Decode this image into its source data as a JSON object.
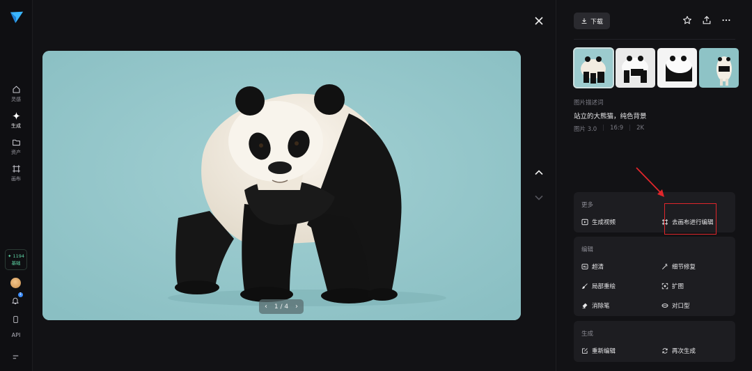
{
  "sidebar": {
    "items": [
      {
        "label": "灵感"
      },
      {
        "label": "生成"
      },
      {
        "label": "资产"
      },
      {
        "label": "画布"
      }
    ],
    "credits": {
      "value": "1194",
      "label": "基础"
    },
    "notification_count": "1",
    "api_label": "API"
  },
  "viewer": {
    "pager": {
      "current": "1",
      "separator": "/",
      "total": "4"
    }
  },
  "panel": {
    "download_label": "下载",
    "description_label": "图片描述词",
    "description_text": "站立的大熊猫，纯色背景",
    "meta": {
      "model": "图片 3.0",
      "ratio": "16:9",
      "resolution": "2K"
    },
    "more": {
      "title": "更多",
      "actions": [
        {
          "label": "生成视频"
        },
        {
          "label": "去画布进行编辑"
        }
      ]
    },
    "edit": {
      "title": "编辑",
      "actions": [
        {
          "label": "超清"
        },
        {
          "label": "细节修复"
        },
        {
          "label": "局部重绘"
        },
        {
          "label": "扩图"
        },
        {
          "label": "消除笔"
        },
        {
          "label": "对口型"
        }
      ]
    },
    "generate": {
      "title": "生成",
      "actions": [
        {
          "label": "重新编辑"
        },
        {
          "label": "再次生成"
        }
      ]
    }
  },
  "colors": {
    "accent_green": "#5fd6a6",
    "annotation_red": "#e0262b",
    "image_background": "#95c5c9"
  }
}
